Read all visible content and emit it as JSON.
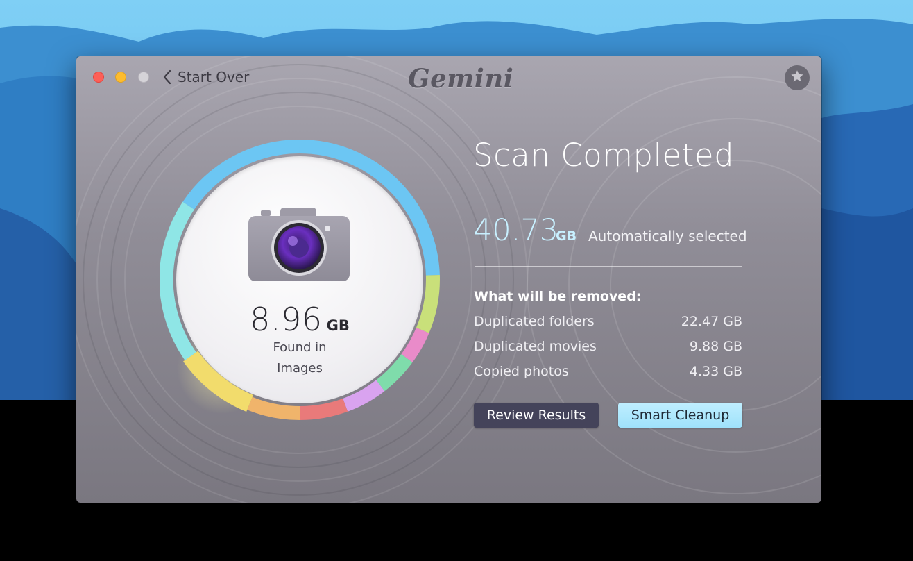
{
  "window": {
    "back_label": "Start Over",
    "app_logo": "Gemini",
    "favorite_icon": "star-icon"
  },
  "summary": {
    "found_size_value": "8.96",
    "found_size_unit": "GB",
    "found_line_1": "Found in",
    "found_line_2": "Images",
    "category_icon": "camera-icon"
  },
  "results": {
    "title": "Scan Completed",
    "total_value": "40.73",
    "total_unit": "GB",
    "total_label": "Automatically selected",
    "removed_title": "What will be removed:",
    "rows": [
      {
        "label": "Duplicated folders",
        "value": "22.47 GB"
      },
      {
        "label": "Duplicated movies",
        "value": "9.88 GB"
      },
      {
        "label": "Copied photos",
        "value": "4.33 GB"
      }
    ]
  },
  "actions": {
    "review_label": "Review Results",
    "smart_label": "Smart Cleanup"
  },
  "colors": {
    "accent_blue": "#6cc6f3",
    "segment_cyan": "#6fe0e0",
    "segment_lime": "#c9e07a",
    "segment_pink": "#e98bc9",
    "segment_green": "#7fdcab",
    "segment_violet": "#d9a3ef",
    "segment_red": "#e97a7a",
    "segment_orange": "#f0b46b",
    "segment_yellow": "#f2dc6c"
  }
}
